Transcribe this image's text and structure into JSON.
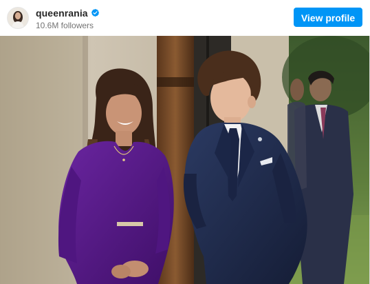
{
  "post": {
    "username": "queenrania",
    "followers": "10.6M followers",
    "view_profile_label": "View profile",
    "verified": true
  },
  "icons": {
    "avatar": "profile-avatar",
    "verified": "verified-badge-icon"
  },
  "colors": {
    "button": "#0095f6",
    "verified": "#0095f6",
    "dress": "#5b1c8c",
    "suit": "#1f2c4d"
  }
}
